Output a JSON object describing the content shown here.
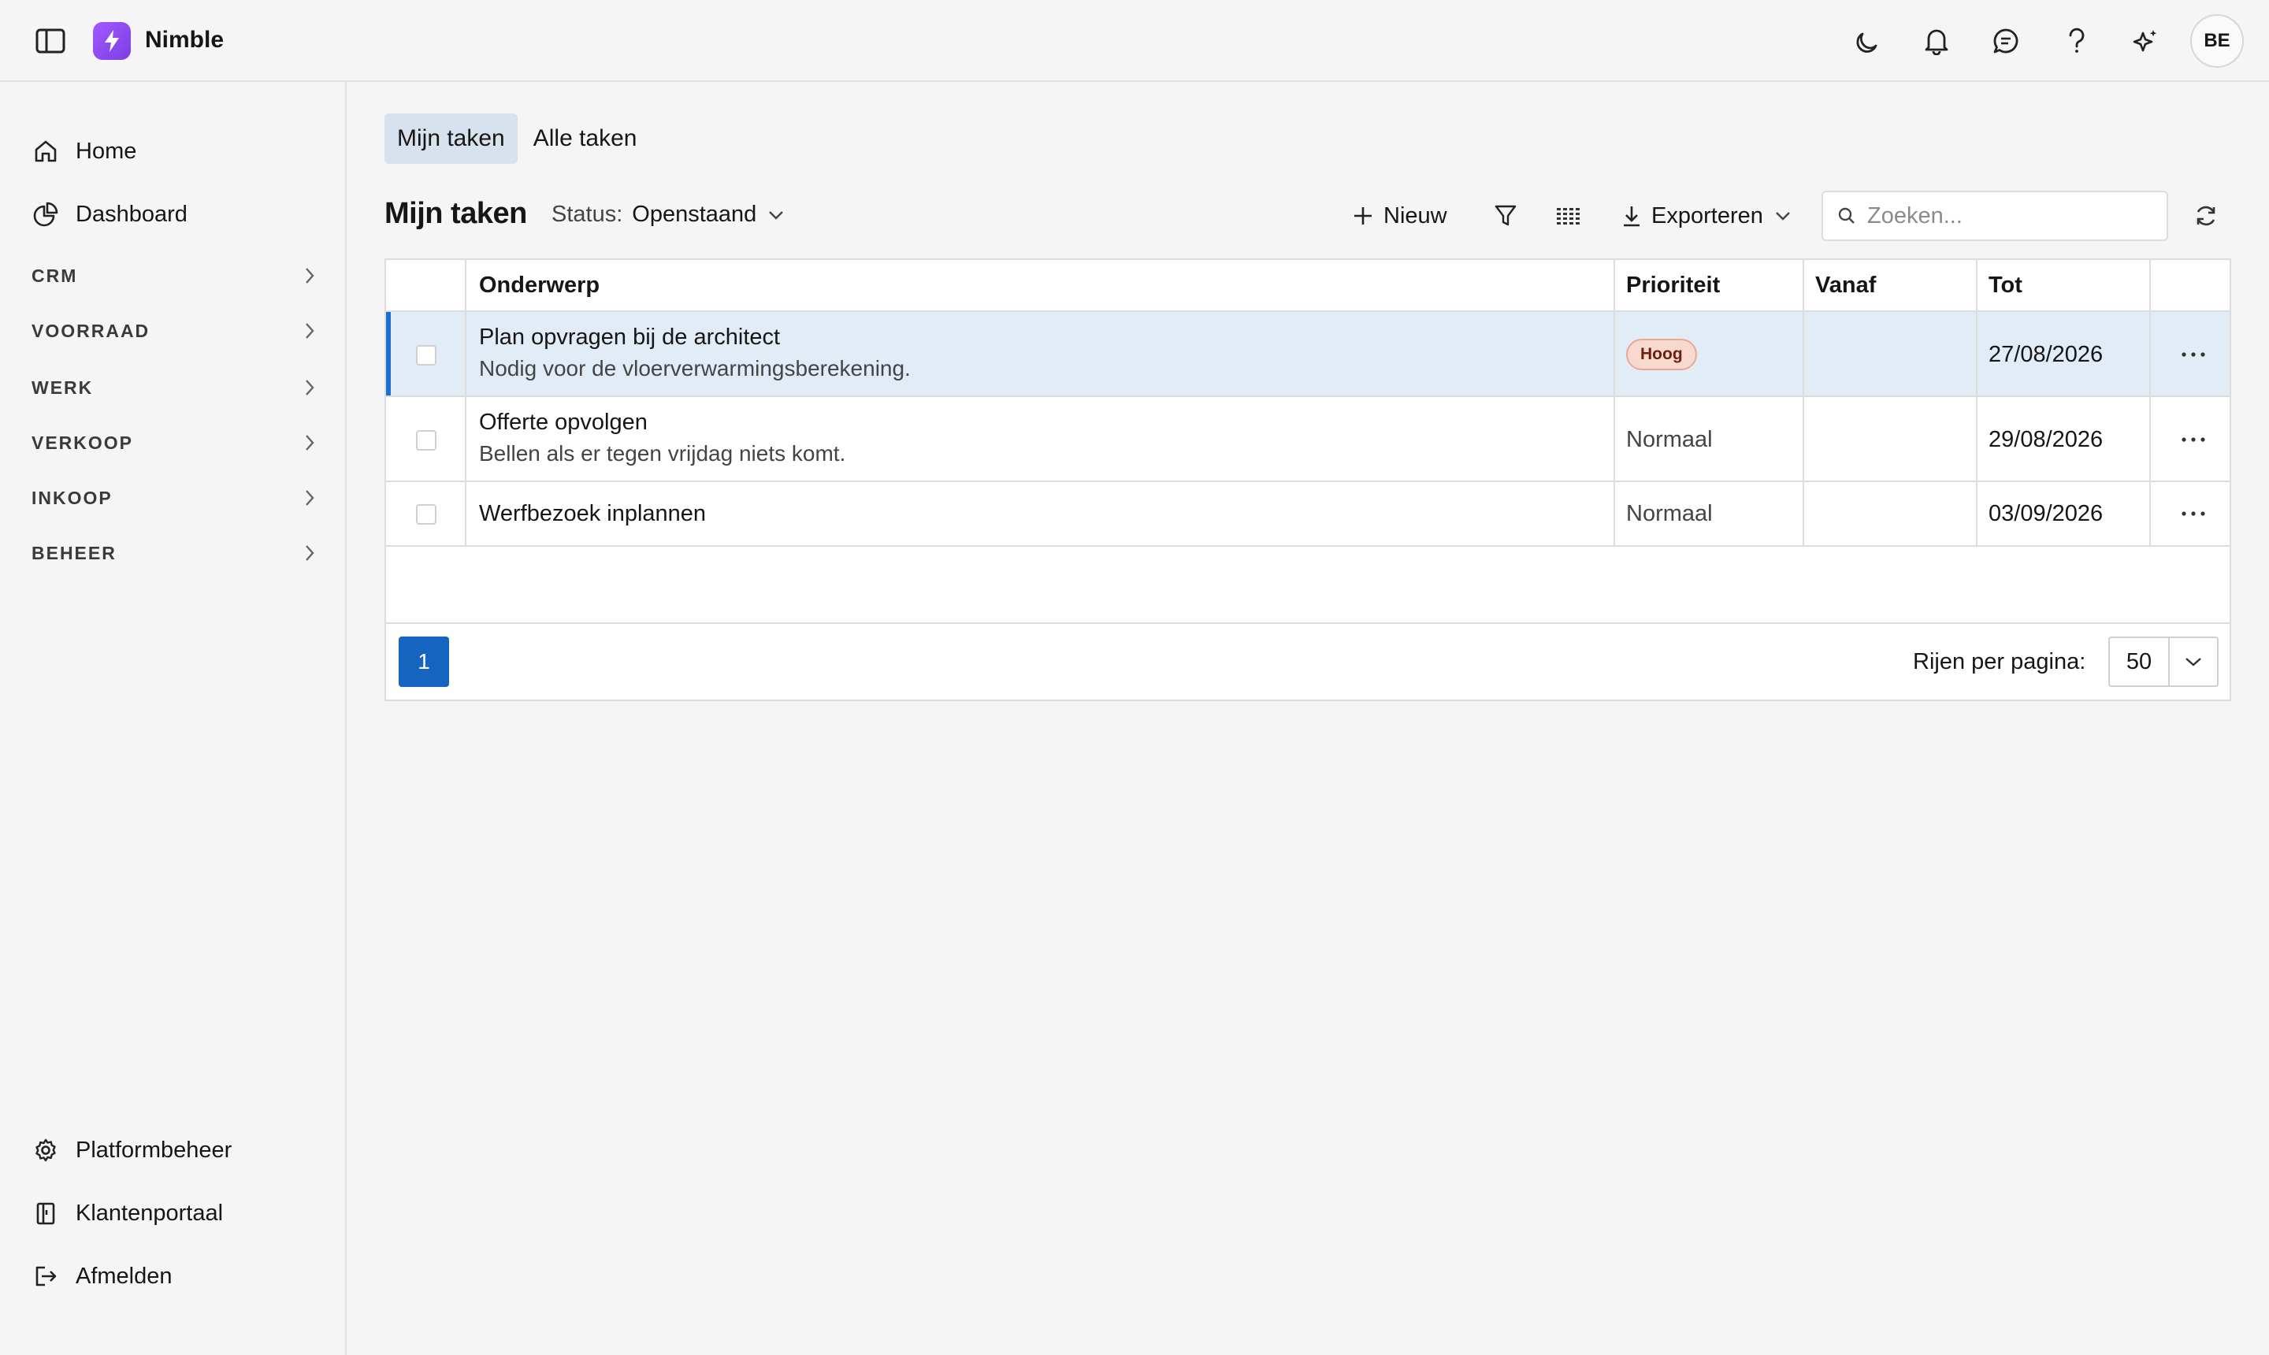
{
  "app": {
    "name": "Nimble",
    "accent": "#8b4cf0"
  },
  "header": {
    "icons": [
      "moon-icon",
      "bell-icon",
      "chat-icon",
      "help-icon",
      "sparkle-icon"
    ],
    "avatar_initials": "BE"
  },
  "sidebar": {
    "items": [
      {
        "label": "Home",
        "icon": "home-icon"
      },
      {
        "label": "Dashboard",
        "icon": "pie-chart-icon"
      }
    ],
    "sections": [
      "CRM",
      "VOORRAAD",
      "WERK",
      "VERKOOP",
      "INKOOP",
      "BEHEER"
    ],
    "bottom_items": [
      {
        "label": "Platformbeheer",
        "icon": "gear-icon"
      },
      {
        "label": "Klantenportaal",
        "icon": "book-icon"
      },
      {
        "label": "Afmelden",
        "icon": "logout-icon"
      }
    ]
  },
  "tabs": [
    {
      "label": "Mijn taken",
      "active": true
    },
    {
      "label": "Alle taken",
      "active": false
    }
  ],
  "page": {
    "title": "Mijn taken",
    "status_label": "Status:",
    "status_value": "Openstaand"
  },
  "toolbar": {
    "new_label": "Nieuw",
    "export_label": "Exporteren",
    "search_placeholder": "Zoeken..."
  },
  "table": {
    "columns": [
      "Onderwerp",
      "Prioriteit",
      "Vanaf",
      "Tot"
    ],
    "rows": [
      {
        "title": "Plan opvragen bij de architect",
        "subtitle": "Nodig voor de vloerverwarmingsberekening.",
        "priority": "Hoog",
        "priority_badge": true,
        "from": "",
        "to": "27/08/2026",
        "selected": true
      },
      {
        "title": "Offerte opvolgen",
        "subtitle": "Bellen als er tegen vrijdag niets komt.",
        "priority": "Normaal",
        "priority_badge": false,
        "from": "",
        "to": "29/08/2026",
        "selected": false
      },
      {
        "title": "Werfbezoek inplannen",
        "subtitle": "",
        "priority": "Normaal",
        "priority_badge": false,
        "from": "",
        "to": "03/09/2026",
        "selected": false
      }
    ]
  },
  "pagination": {
    "current_page": "1",
    "rows_per_page_label": "Rijen per pagina:",
    "rows_per_page": "50"
  }
}
